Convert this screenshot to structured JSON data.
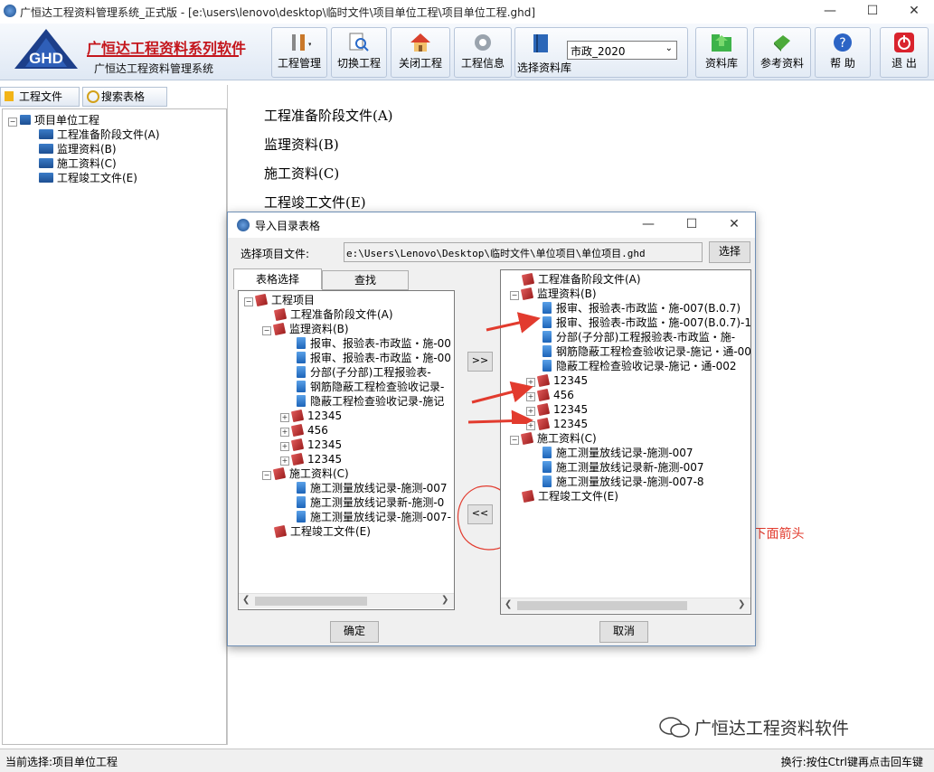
{
  "window": {
    "title": "广恒达工程资料管理系统_正式版 - [e:\\users\\lenovo\\desktop\\临时文件\\项目单位工程\\项目单位工程.ghd]",
    "min": "—",
    "max": "☐",
    "close": "✕"
  },
  "brand": {
    "logo_text": "GHD",
    "name": "广恒达工程资料系列软件",
    "subtitle": "广恒达工程资料管理系统"
  },
  "toolbar": {
    "project_mgmt": "工程管理",
    "switch_project": "切换工程",
    "close_project": "关闭工程",
    "project_info": "工程信息",
    "select_library": "选择资料库",
    "library_value": "市政_2020",
    "library": "资料库",
    "reference": "参考资料",
    "help": "帮 助",
    "exit": "退 出"
  },
  "left_panel": {
    "tab_files": "工程文件",
    "tab_search": "搜索表格",
    "root": "项目单位工程",
    "items": [
      "工程准备阶段文件(A)",
      "监理资料(B)",
      "施工资料(C)",
      "工程竣工文件(E)"
    ]
  },
  "main": {
    "items": [
      "工程准备阶段文件(A)",
      "监理资料(B)",
      "施工资料(C)",
      "工程竣工文件(E)"
    ]
  },
  "dialog": {
    "title": "导入目录表格",
    "file_label": "选择项目文件:",
    "file_value": "e:\\Users\\Lenovo\\Desktop\\临时文件\\单位项目\\单位项目.ghd",
    "choose_button": "选择",
    "tab_table": "表格选择",
    "tab_find": "查找",
    "add_button": ">>",
    "remove_button": "<<",
    "ok_button": "确定",
    "cancel_button": "取消",
    "left_tree": {
      "root": "工程项目",
      "a": "工程准备阶段文件(A)",
      "b": "监理资料(B)",
      "b_items": [
        "报审、报验表-市政监・施-00",
        "报审、报验表-市政监・施-00",
        "分部(子分部)工程报验表-"
      ],
      "b_items2": [
        "钢筋隐蔽工程检查验收记录-",
        "隐蔽工程检查验收记录-施记"
      ],
      "b_folders": [
        "12345",
        "456",
        "12345",
        "12345"
      ],
      "c": "施工资料(C)",
      "c_items": [
        "施工测量放线记录-施测-007",
        "施工测量放线记录新-施测-0",
        "施工测量放线记录-施测-007-"
      ],
      "e": "工程竣工文件(E)"
    },
    "right_tree": {
      "a": "工程准备阶段文件(A)",
      "b": "监理资料(B)",
      "b_items": [
        "报审、报验表-市政监・施-007(B.0.7)",
        "报审、报验表-市政监・施-007(B.0.7)-1",
        "分部(子分部)工程报验表-市政监・施-"
      ],
      "b_items2": [
        "钢筋隐蔽工程检查验收记录-施记・通-00",
        "隐蔽工程检查验收记录-施记・通-002"
      ],
      "b_folders": [
        "12345",
        "456",
        "12345",
        "12345"
      ],
      "c": "施工资料(C)",
      "c_items": [
        "施工测量放线记录-施测-007",
        "施工测量放线记录新-施测-007",
        "施工测量放线记录-施测-007-8"
      ],
      "e": "工程竣工文件(E)"
    }
  },
  "annotation": {
    "text": "选择需要删除的目录或表格,点击下面箭头",
    "color": "#e23b2e"
  },
  "watermark": "广恒达工程资料软件",
  "status": {
    "left": "当前选择:项目单位工程",
    "right": "换行:按住Ctrl键再点击回车键"
  }
}
